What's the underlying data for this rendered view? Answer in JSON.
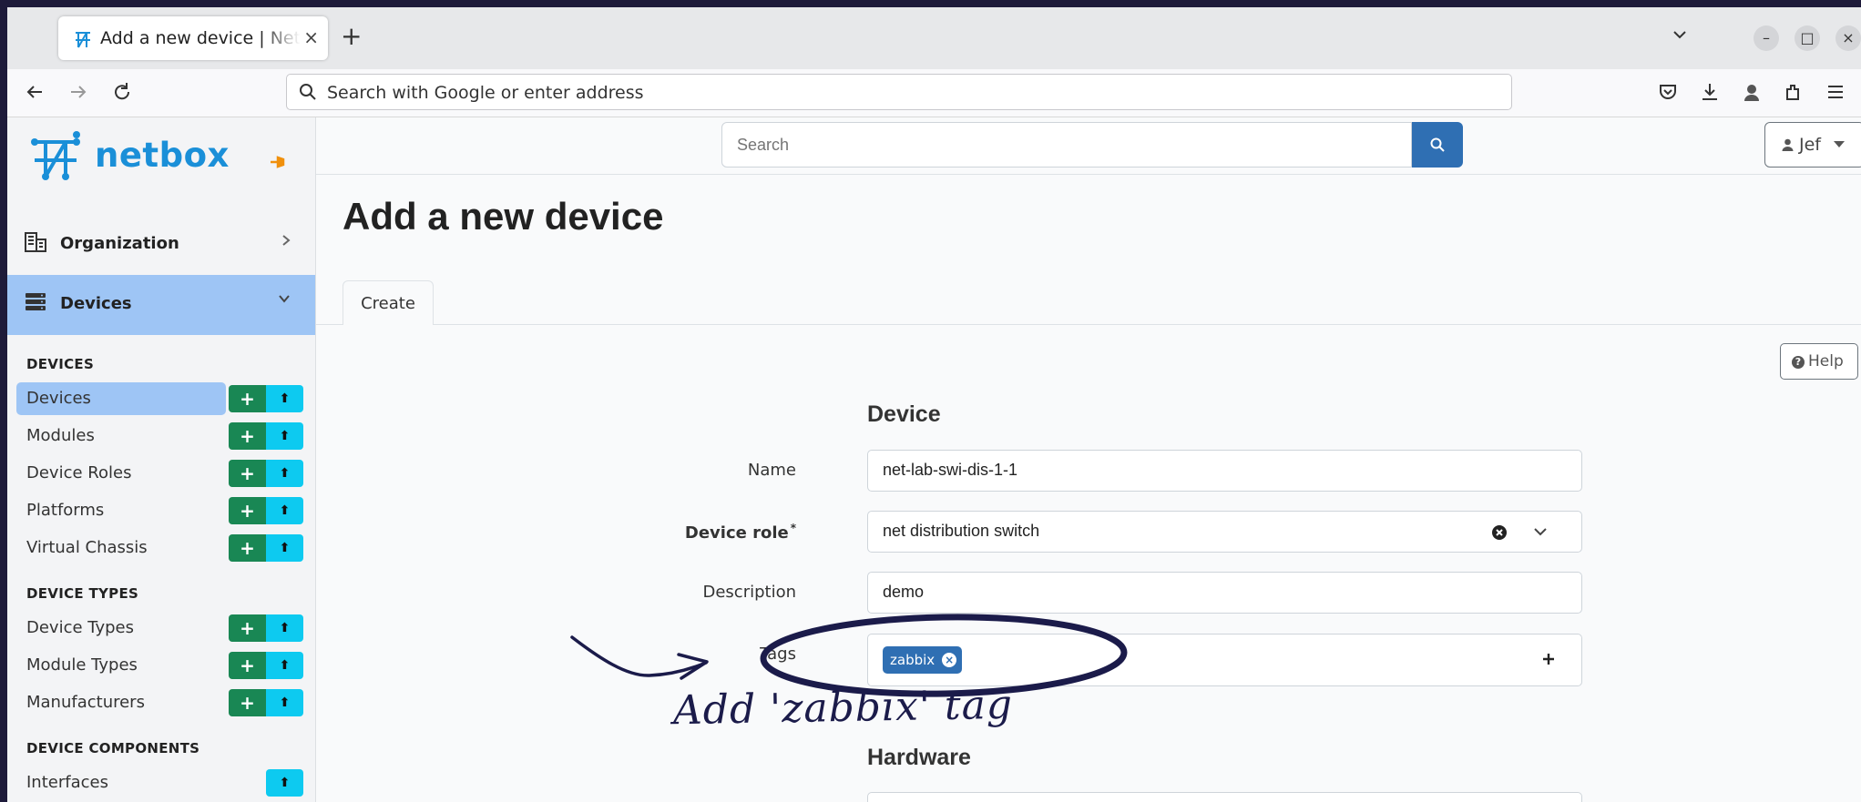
{
  "browser": {
    "tab_title": "Add a new device | NetBox",
    "tab_close": "×",
    "new_tab": "+",
    "url_placeholder": "Search with Google or enter address"
  },
  "brand": {
    "name": "netbox"
  },
  "sidebar": {
    "organization_label": "Organization",
    "devices_label": "Devices",
    "sections": {
      "devices_title": "DEVICES",
      "device_types_title": "DEVICE TYPES",
      "device_components_title": "DEVICE COMPONENTS"
    },
    "items": [
      {
        "label": "Devices"
      },
      {
        "label": "Modules"
      },
      {
        "label": "Device Roles"
      },
      {
        "label": "Platforms"
      },
      {
        "label": "Virtual Chassis"
      },
      {
        "label": "Device Types"
      },
      {
        "label": "Module Types"
      },
      {
        "label": "Manufacturers"
      },
      {
        "label": "Interfaces"
      }
    ]
  },
  "topbar": {
    "search_placeholder": "Search",
    "user_label": "Jef"
  },
  "page": {
    "title": "Add a new device",
    "tab_create": "Create",
    "help_label": "Help"
  },
  "form": {
    "device_heading": "Device",
    "hardware_heading": "Hardware",
    "name_label": "Name",
    "name_value": "net-lab-swi-dis-1-1",
    "role_label": "Device role",
    "role_required": "*",
    "role_value": "net distribution switch",
    "description_label": "Description",
    "description_value": "demo",
    "tags_label": "Tags",
    "tag_value": "zabbix"
  },
  "annotation": {
    "text": "Add 'zabbix' tag"
  },
  "colors": {
    "accent": "#2f6fb3",
    "brand": "#1a8fd8",
    "active_item": "#9ec5f5",
    "add_button": "#198754",
    "import_button": "#0dcaf0",
    "annotation_ink": "#1b1b4a"
  }
}
